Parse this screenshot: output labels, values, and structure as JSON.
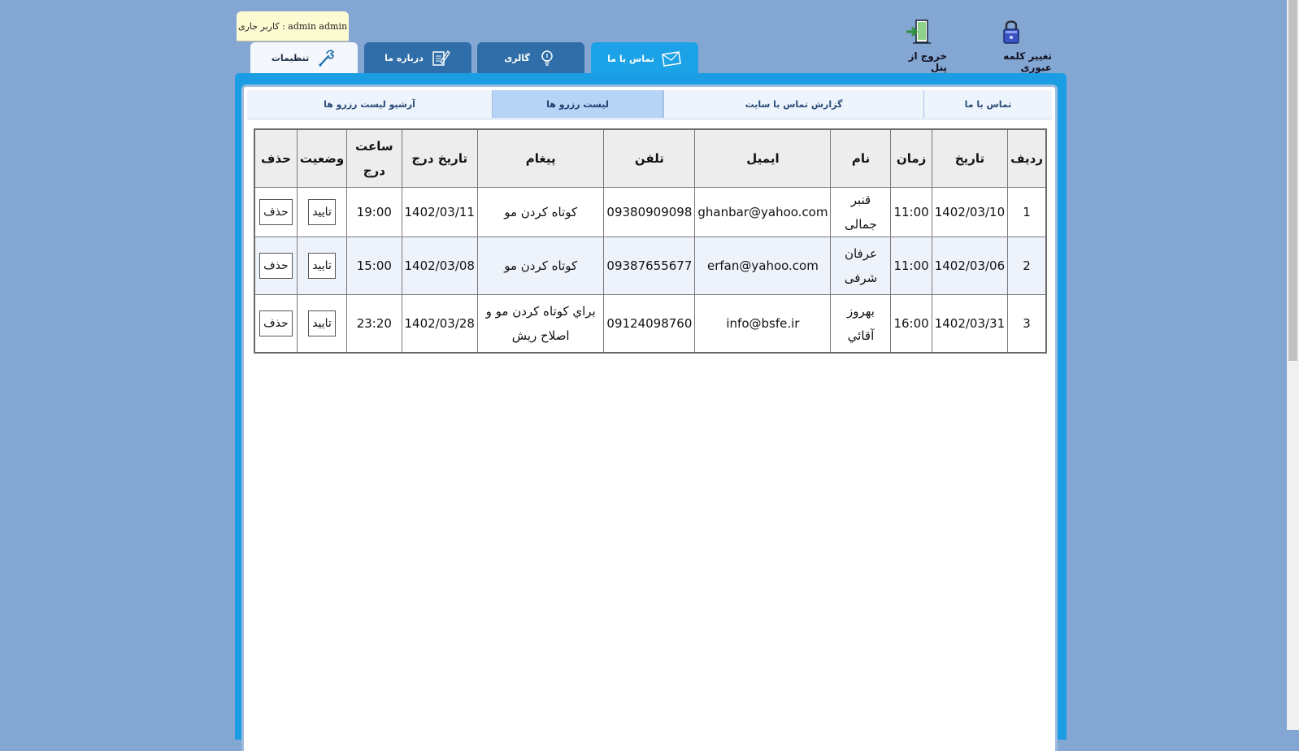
{
  "user_badge": {
    "label": "admin admin : کاربر جاری"
  },
  "main_tabs": {
    "settings": "تنظیمات",
    "about": "درباره ما",
    "gallery": "گالری",
    "contact": "تماس با ما"
  },
  "top_actions": {
    "logout": "خروج از پنل",
    "change_password": "تغییر کلمه عبوری"
  },
  "sub_tabs": {
    "contact_us": "تماس با ما",
    "site_contact_report": "گزارش تماس با سایت",
    "reservations": "لیست رزرو ها",
    "reservations_archive": "آرشیو لیست رزرو ها"
  },
  "table": {
    "headers": {
      "row": "ردیف",
      "date": "تاریخ",
      "time": "زمان",
      "name": "نام",
      "email": "ایمیل",
      "phone": "تلفن",
      "message": "پیغام",
      "insert_date": "تاریخ درج",
      "insert_time": "ساعت درج",
      "status": "وضعیت",
      "delete": "حذف"
    },
    "rows": [
      {
        "row": "1",
        "date": "1402/03/10",
        "time": "11:00",
        "name": "قنبر جمالی",
        "email": "ghanbar@yahoo.com",
        "phone": "09380909098",
        "message": "کوتاه کردن مو",
        "insert_date": "1402/03/11",
        "insert_time": "19:00",
        "confirm": "تایید",
        "delete": "حذف"
      },
      {
        "row": "2",
        "date": "1402/03/06",
        "time": "11:00",
        "name": "عرفان شرفی",
        "email": "erfan@yahoo.com",
        "phone": "09387655677",
        "message": "کوتاه کردن مو",
        "insert_date": "1402/03/08",
        "insert_time": "15:00",
        "confirm": "تایید",
        "delete": "حذف"
      },
      {
        "row": "3",
        "date": "1402/03/31",
        "time": "16:00",
        "name": "بهروز آقائي",
        "email": "info@bsfe.ir",
        "phone": "09124098760",
        "message": "براي كوتاه كردن مو و اصلاح ريش",
        "insert_date": "1402/03/28",
        "insert_time": "23:20",
        "confirm": "تایید",
        "delete": "حذف"
      }
    ]
  },
  "colors": {
    "page_bg": "#84a6d2",
    "frame": "#1a9de3",
    "tab_active": "#1ca2e6",
    "tab_dark": "#2f6ea8"
  }
}
